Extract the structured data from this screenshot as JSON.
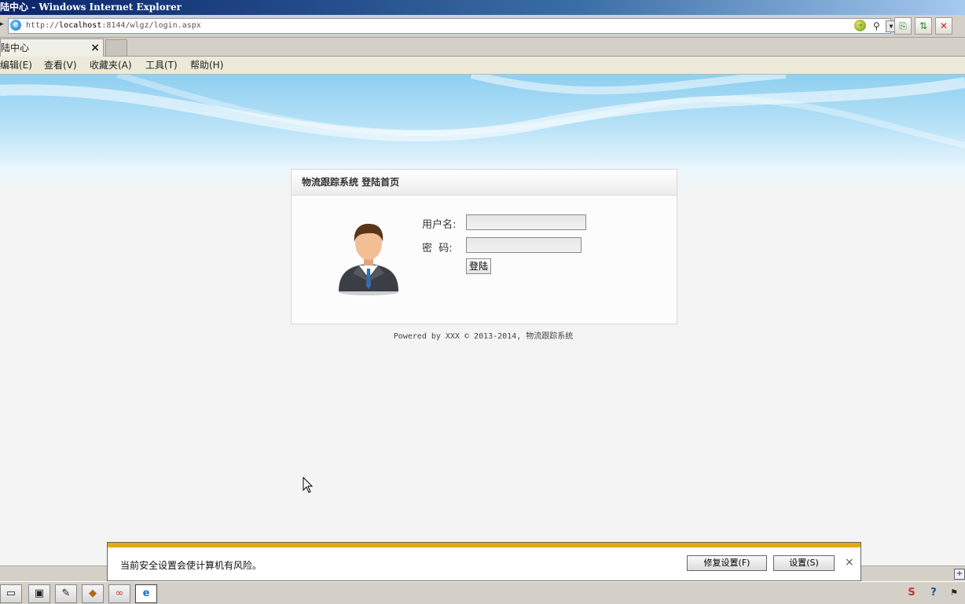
{
  "window": {
    "title": "陆中心 - Windows Internet Explorer"
  },
  "addressbar": {
    "url_prefix": "http://",
    "url_host": "localhost",
    "url_rest": ":8144/wlgz/login.aspx"
  },
  "tab": {
    "label": "陆中心",
    "close": "×"
  },
  "menu": {
    "items": [
      "编辑(E)",
      "查看(V)",
      "收藏夹(A)",
      "工具(T)",
      "帮助(H)"
    ]
  },
  "login": {
    "header": "物流跟踪系统 登陆首页",
    "username_label": "用户名:",
    "password_label": "密  码:",
    "username_value": "",
    "password_value": "",
    "submit_label": "登陆"
  },
  "footer": {
    "text": "Powered by XXX © 2013-2014, 物流跟踪系统"
  },
  "security_bar": {
    "message": "当前安全设置会使计算机有风险。",
    "fix_label": "修复设置(F)",
    "settings_label": "设置(S)",
    "close": "×"
  },
  "colors": {
    "warning_stripe": "#e5a714",
    "title_bar": "#0a246a",
    "sky": "#8fcff0"
  },
  "icons": {
    "addr": "ie-icon",
    "go": "go-icon",
    "search": "search-icon",
    "refresh": "refresh-icon",
    "back_forward": "arrows-icon",
    "stop": "stop-icon"
  }
}
